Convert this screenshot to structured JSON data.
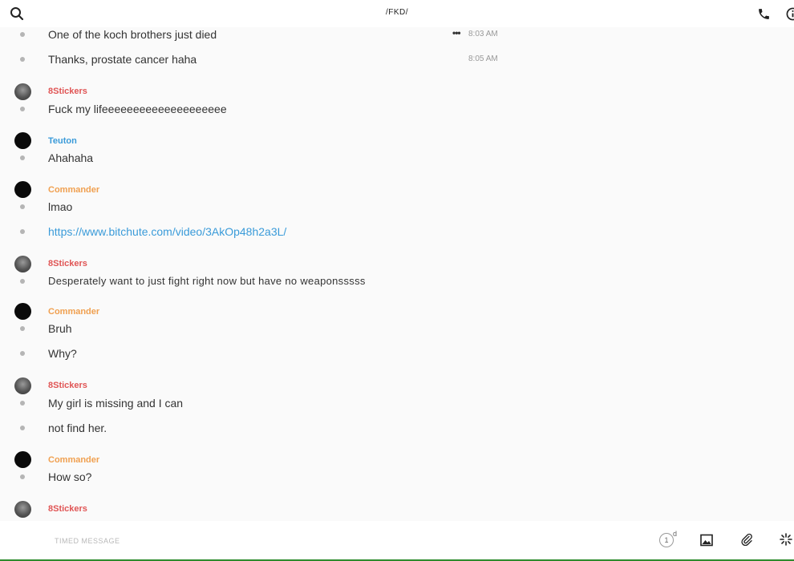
{
  "header": {
    "title": "/FKD/",
    "icons": [
      "search-icon",
      "phone-icon",
      "info-icon"
    ]
  },
  "messages": [
    {
      "text": "One of the koch brothers just died",
      "time": "8:03 AM"
    },
    {
      "text": "Thanks, prostate cancer haha",
      "time": "8:05 AM"
    },
    {
      "sender": "8Stickers",
      "sender_color": "#e05555",
      "avatar": "gray",
      "text": "Fuck my lifeeeeeeeeeeeeeeeeeeee"
    },
    {
      "sender": "Teuton",
      "sender_color": "#3a9bd9",
      "avatar": "black",
      "text": "Ahahaha"
    },
    {
      "sender": "Commander",
      "sender_color": "#f0a050",
      "avatar": "black",
      "text": "lmao"
    },
    {
      "text": "https://www.bitchute.com/video/3AkOp48h2a3L/",
      "is_link": true
    },
    {
      "sender": "8Stickers",
      "sender_color": "#e05555",
      "avatar": "gray",
      "text": "Desperately want to just fight right now but have no weaponsssss"
    },
    {
      "sender": "Commander",
      "sender_color": "#f0a050",
      "avatar": "black",
      "text": "Bruh"
    },
    {
      "text": "Why?"
    },
    {
      "sender": "8Stickers",
      "sender_color": "#e05555",
      "avatar": "gray",
      "text": "My girl is missing and I can"
    },
    {
      "text": "not find her."
    },
    {
      "sender": "Commander",
      "sender_color": "#f0a050",
      "avatar": "black",
      "text": "How so?"
    },
    {
      "sender": "8Stickers",
      "sender_color": "#e05555",
      "avatar": "gray"
    }
  ],
  "composer": {
    "placeholder": "TIMED MESSAGE",
    "timer_value": "1",
    "timer_unit": "d",
    "icons": [
      "image-icon",
      "paperclip-icon",
      "sparkle-icon"
    ]
  },
  "colors": {
    "link": "#3a9bd9",
    "background": "#fafafa",
    "status_bar": "#2e8b2e"
  }
}
